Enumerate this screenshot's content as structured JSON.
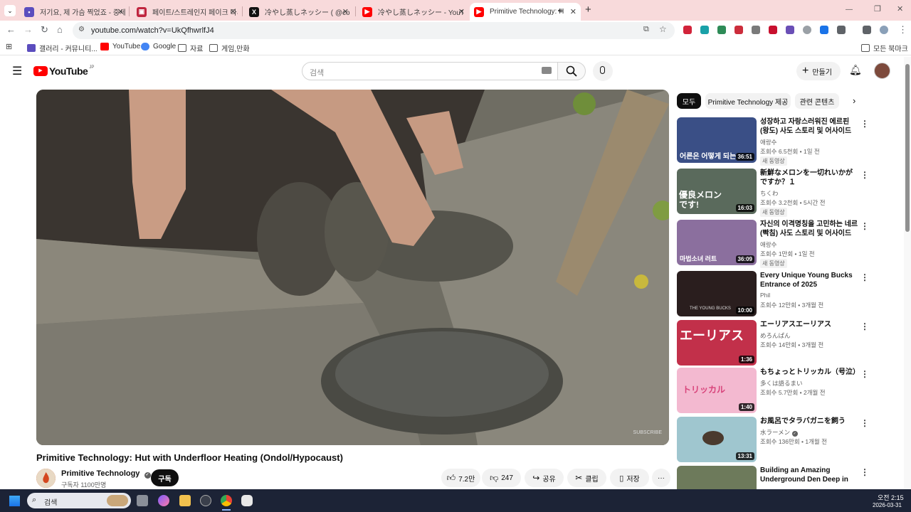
{
  "browser": {
    "tabs": [
      {
        "title": "저기요, 제 가슴 찍었죠 - 중세 ",
        "active": false
      },
      {
        "title": "페이트/스트레인지 페이크 다시",
        "active": false
      },
      {
        "title": "冷やし蒸しネッシー ( @coldstea",
        "active": false
      },
      {
        "title": "冷やし蒸しネッシー - YouTube",
        "active": false
      },
      {
        "title": "Primitive Technology: Hut",
        "active": true
      }
    ],
    "new_tab_label": "+",
    "url": "youtube.com/watch?v=UkQfhwrlfJ4",
    "bookmarks": [
      "갤러리 - 커뮤니티...",
      "YouTube",
      "Google",
      "자료",
      "게임,만화"
    ],
    "all_bookmarks": "모든 북마크"
  },
  "youtube": {
    "logo_text": "YouTube",
    "logo_region": "JP",
    "search_placeholder": "검색",
    "create_label": "만들기"
  },
  "video": {
    "title": "Primitive Technology: Hut with Underfloor Heating (Ondol/Hypocaust)",
    "channel": "Primitive Technology",
    "subscribers": "구독자 1100만명",
    "subscribe_label": "구독",
    "likes": "7.2만",
    "dislikes": "247",
    "share_label": "공유",
    "clip_label": "클립",
    "save_label": "저장",
    "more_label": "···"
  },
  "sidebar": {
    "chips": [
      "모두",
      "Primitive Technology 제공",
      "관련 콘텐츠"
    ],
    "recommendations": [
      {
        "title": "성장하고 자랑스러워진 에르핀 (왕도) 사도 스토리 및 어사이드 이야...",
        "channel": "애랑수",
        "meta": "조회수 6.5천회 • 1일 전",
        "badge": "새 동영상",
        "duration": "36:51",
        "thumb_text": "어른은 어떻게 되는",
        "thumb_color": "#3a4f86"
      },
      {
        "title": "新鮮なメロンを一切れいかがですか？１",
        "channel": "ちくわ",
        "meta": "조회수 3.2천회 • 5시간 전",
        "badge": "새 동영상",
        "duration": "16:03",
        "thumb_text": "優良メロンです!",
        "thumb_color": "#5a6a5c"
      },
      {
        "title": "자신의 이격명칭을 고민하는 네르 (빡침) 사도 스토리 및 어사이드 ...",
        "channel": "애랑수",
        "meta": "조회수 1만회 • 1일 전",
        "badge": "새 동영상",
        "duration": "36:09",
        "thumb_text": "마법소녀 러트",
        "thumb_color": "#8b6f9e"
      },
      {
        "title": "Every Unique Young Bucks Entrance of 2025",
        "channel": "Phil",
        "meta": "조회수 12만회 • 3개월 전",
        "badge": "",
        "duration": "10:00",
        "thumb_text": "THE YOUNG BUCKS",
        "thumb_color": "#2a1e1e"
      },
      {
        "title": "エーリアスエーリアス",
        "channel": "めろんぱん",
        "meta": "조회수 14만회 • 3개월 전",
        "badge": "",
        "duration": "1:36",
        "thumb_text": "エーリアス",
        "thumb_color": "#c2304a"
      },
      {
        "title": "もちょっとトリッカル（号泣）",
        "channel": "多くは語るまい",
        "meta": "조회수 5.7만회 • 2개월 전",
        "badge": "",
        "duration": "1:40",
        "thumb_text": "トリッカル",
        "thumb_color": "#f3b9d0"
      },
      {
        "title": "お風呂でタラバガニを飼う",
        "channel": "水ラーメン",
        "meta": "조회수 136만회 • 1개월 전",
        "badge": "",
        "duration": "13:31",
        "thumb_text": "",
        "thumb_color": "#9fc6cf"
      },
      {
        "title": "Building an Amazing Underground Den Deep in the ...",
        "channel": "",
        "meta": "",
        "badge": "",
        "duration": "",
        "thumb_text": "",
        "thumb_color": "#6d7a5b"
      }
    ]
  },
  "taskbar": {
    "search_placeholder": "검색",
    "time": "오전 2:15",
    "date": "2026-03-31"
  }
}
